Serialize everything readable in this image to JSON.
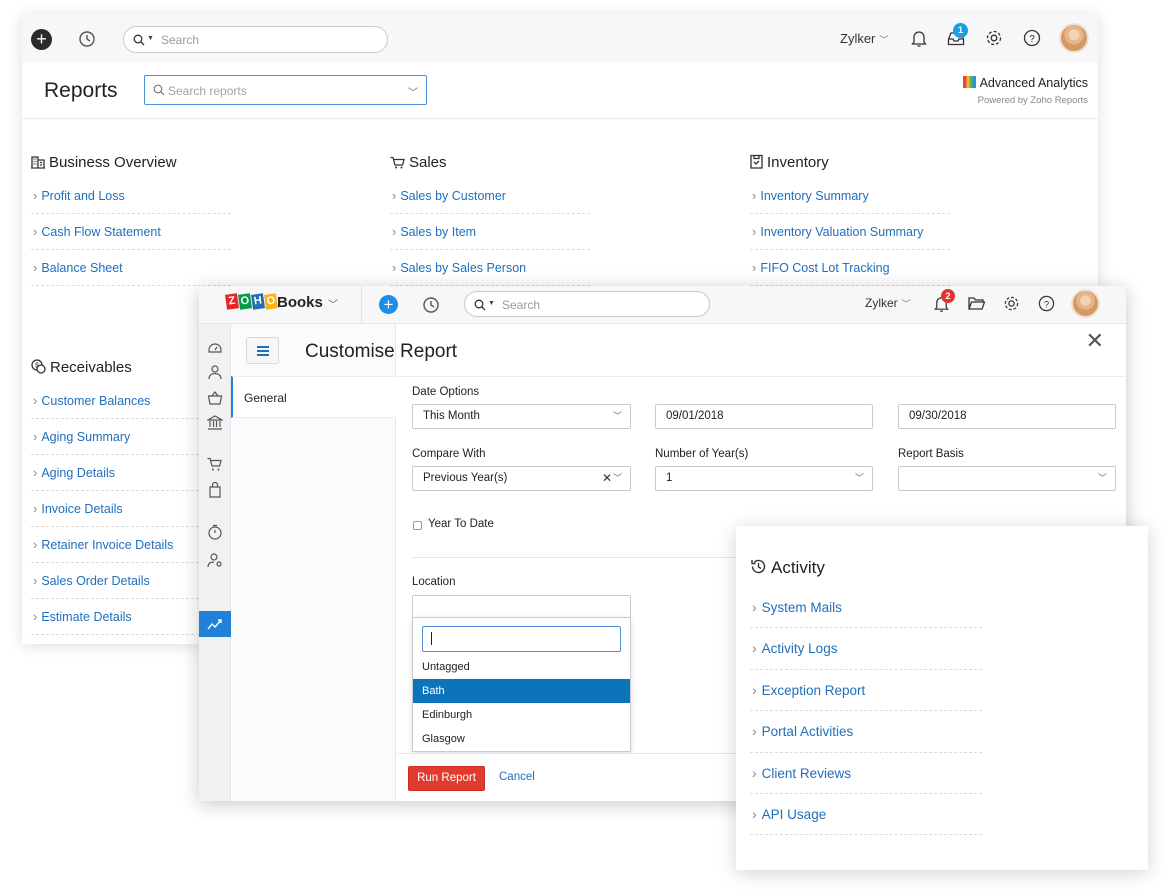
{
  "back_window": {
    "topbar": {
      "search_placeholder": "Search",
      "org_name": "Zylker",
      "notification_badge": "1"
    },
    "title": "Reports",
    "reports_search_placeholder": "Search reports",
    "advanced_analytics": {
      "title": "Advanced Analytics",
      "subtitle": "Powered by Zoho Reports"
    },
    "groups": {
      "business_overview": {
        "title": "Business Overview",
        "items": [
          "Profit and Loss",
          "Cash Flow Statement",
          "Balance Sheet"
        ]
      },
      "sales": {
        "title": "Sales",
        "items": [
          "Sales by Customer",
          "Sales by Item",
          "Sales by Sales Person"
        ]
      },
      "inventory": {
        "title": "Inventory",
        "items": [
          "Inventory Summary",
          "Inventory Valuation Summary",
          "FIFO Cost Lot Tracking"
        ]
      },
      "receivables": {
        "title": "Receivables",
        "items": [
          "Customer Balances",
          "Aging Summary",
          "Aging Details",
          "Invoice Details",
          "Retainer Invoice Details",
          "Sales Order Details",
          "Estimate Details"
        ]
      }
    }
  },
  "middle_window": {
    "topbar": {
      "logo_letters": [
        "Z",
        "O",
        "H",
        "O"
      ],
      "logo_colors": [
        "#e42527",
        "#089949",
        "#226db4",
        "#f9b21d"
      ],
      "product": "Books",
      "search_placeholder": "Search",
      "org_name": "Zylker",
      "notification_badge": "2"
    },
    "title": "Customise Report",
    "nav_general": "General",
    "form": {
      "date_options_label": "Date Options",
      "date_options_value": "This Month",
      "from_date": "09/01/2018",
      "to_date": "09/30/2018",
      "compare_with_label": "Compare With",
      "compare_with_value": "Previous Year(s)",
      "number_of_years_label": "Number of Year(s)",
      "number_of_years_value": "1",
      "report_basis_label": "Report Basis",
      "report_basis_value": "",
      "year_to_date_label": "Year To Date",
      "year_to_date_checked": false,
      "location_label": "Location",
      "location_options": [
        "Untagged",
        "Bath",
        "Edinburgh",
        "Glasgow"
      ],
      "location_highlighted": "Bath"
    },
    "buttons": {
      "run": "Run Report",
      "cancel": "Cancel"
    }
  },
  "front_window": {
    "title": "Activity",
    "items": [
      "System Mails",
      "Activity Logs",
      "Exception Report",
      "Portal Activities",
      "Client Reviews",
      "API Usage"
    ]
  },
  "colors": {
    "link": "#1f6fbd",
    "accent_blue": "#1f82d6",
    "primary_red": "#e13b2f",
    "highlight": "#0c74bb"
  }
}
